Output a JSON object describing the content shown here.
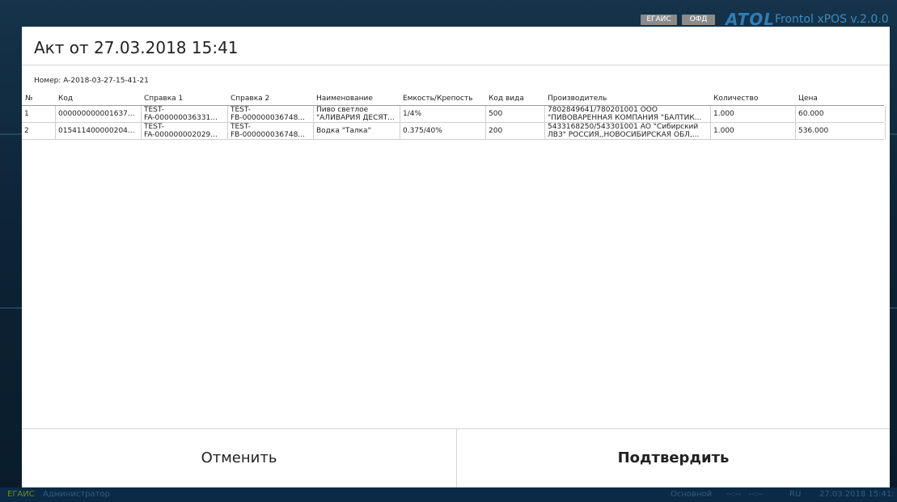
{
  "header": {
    "badges": [
      "ЕГАИС",
      "ОФД"
    ],
    "logo": "ATOL",
    "app_title": "Frontol xPOS v.2.0.0"
  },
  "dialog": {
    "title": "Акт от 27.03.2018 15:41",
    "number": "Номер: A-2018-03-27-15-41-21",
    "columns": [
      "№",
      "Код",
      "Справка 1",
      "Справка 2",
      "Наименование",
      "Емкость/Крепость",
      "Код вида",
      "Производитель",
      "Количество",
      "Цена"
    ],
    "rows": [
      {
        "n": "1",
        "code": "000000000001637...",
        "ref1": [
          "TEST-",
          "FA-000000036331..."
        ],
        "ref2": [
          "TEST-",
          "FB-000000036748..."
        ],
        "name": [
          "Пиво светлое",
          "\"АЛИВАРИЯ ДЕСЯТ..."
        ],
        "volume": "1/4%",
        "kind": "500",
        "producer": [
          "7802849641/780201001 ООО",
          "\"ПИВОВАРЕННАЯ КОМПАНИЯ \"БАЛТИК..."
        ],
        "qty": "1.000",
        "price": "60.000"
      },
      {
        "n": "2",
        "code": "015411400000204...",
        "ref1": [
          "TEST-",
          "FA-000000002029..."
        ],
        "ref2": [
          "TEST-",
          "FB-000000036748..."
        ],
        "name": [
          "Водка \"Талка\""
        ],
        "volume": "0.375/40%",
        "kind": "200",
        "producer": [
          "5433168250/543301001 АО \"Сибирский",
          "ЛВЗ\" РОССИЯ,,НОВОСИБИРСКАЯ ОБЛ,..."
        ],
        "qty": "1.000",
        "price": "536.000"
      }
    ],
    "cancel_label": "Отменить",
    "confirm_label": "Подтвердить"
  },
  "statusbar": {
    "egais": "ЕГАИС",
    "user": "Администратор",
    "mode": "Основной",
    "indicators": "--:--   --:--",
    "lang": "RU",
    "datetime": "27.03.2018 15:41:"
  },
  "colors": {
    "brand_blue": "#2f7fb5",
    "statusbar_bg": "#0b2a45",
    "egais_green": "#6e8a1c"
  }
}
